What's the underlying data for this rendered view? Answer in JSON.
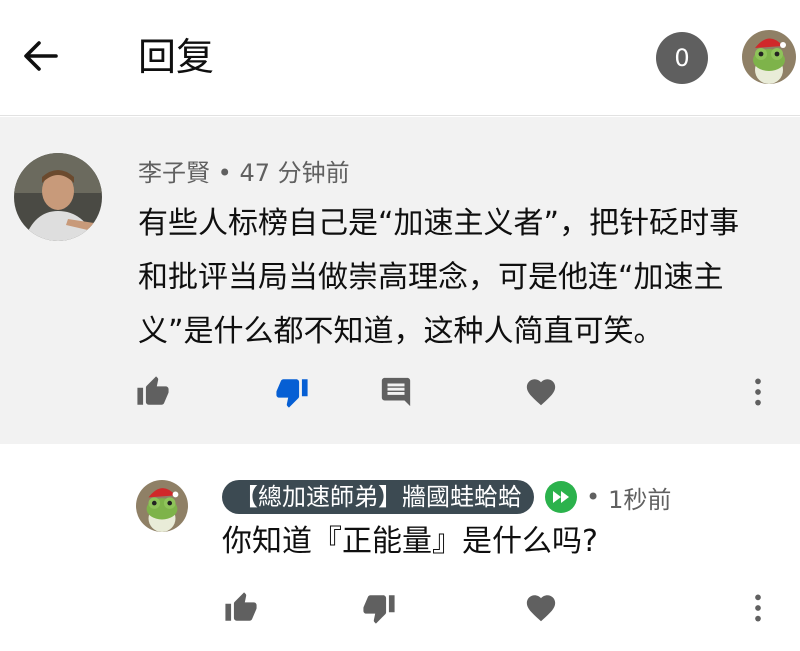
{
  "header": {
    "title": "回复",
    "notification_count": "0"
  },
  "parent_comment": {
    "author": "李子賢",
    "separator": "•",
    "time": "47 分钟前",
    "text": "有些人标榜自己是“加速主义者”，把针砭时事和批评当局当做崇高理念，可是他连“加速主义”是什么都不知道，这种人简直可笑。"
  },
  "reply_comment": {
    "author": "【總加速師弟】牆國蛙蛤蛤",
    "separator": "•",
    "time": "1秒前",
    "text": "你知道『正能量』是什么吗?"
  },
  "icons": [
    "back-arrow-icon",
    "like-icon",
    "dislike-icon",
    "reply-icon",
    "heart-icon",
    "more-vertical-icon",
    "fast-forward-icon"
  ],
  "colors": {
    "dislike_active": "#065fd4",
    "icon_gray": "#606060",
    "badge_bg": "#3c4a52",
    "ff_green": "#2bb24c",
    "parent_bg": "#f2f2f2"
  }
}
